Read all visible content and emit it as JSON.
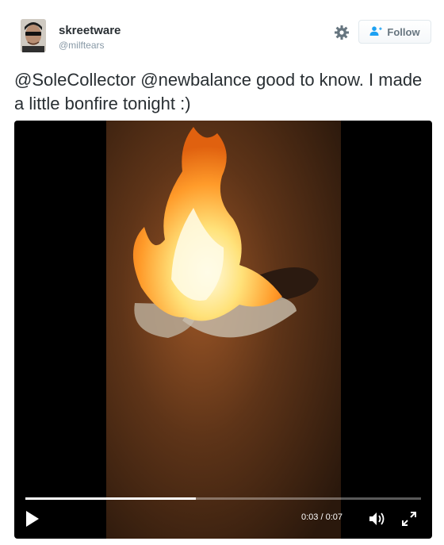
{
  "tweet": {
    "user": {
      "name": "skreetware",
      "handle": "@milftears",
      "avatar_icon": "avatar"
    },
    "settings_icon": "gear-icon",
    "follow_label": "Follow",
    "follow_icon": "add-user-icon",
    "text": "@SoleCollector @newbalance good to know. I made a little bonfire tonight :)"
  },
  "video": {
    "current_time": "0:03",
    "duration": "0:07",
    "time_display": "0:03 / 0:07",
    "progress": 0.43,
    "controls": [
      "play-icon",
      "volume-icon",
      "fullscreen-icon"
    ]
  },
  "colors": {
    "text": "#292f33",
    "muted": "#8899a6",
    "follow_text": "#66757f",
    "follow_icon": "#1da1f2",
    "video_bg": "#000000"
  }
}
